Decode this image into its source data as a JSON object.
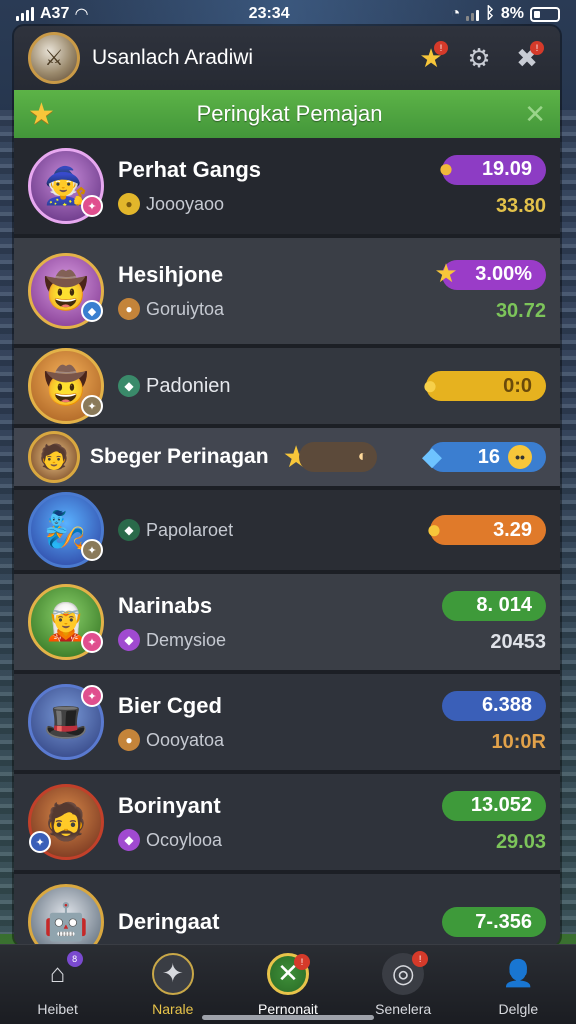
{
  "status": {
    "carrier": "A37",
    "time": "23:34",
    "battery": "8%"
  },
  "header": {
    "title": "Usanlach Aradiwi"
  },
  "banner": {
    "title": "Peringkat Pemajan"
  },
  "players": [
    {
      "name": "Perhat Gangs",
      "sub": "Joooyaoo",
      "pill": "19.09",
      "pill_color": "#8d3cc4",
      "value": "33.80",
      "value_color": "#e2c14a"
    },
    {
      "name": "Hesihjone",
      "sub": "Goruiytoa",
      "pill": "3.00%",
      "pill_color": "#9a3cc8",
      "value": "30.72",
      "value_color": "#7cc45a"
    },
    {
      "name": "",
      "sub": "Padonien",
      "pill": "0:0",
      "pill_color": "#e6b21f",
      "value": ""
    },
    {
      "name": "Sbeger Perinagan",
      "sub": "",
      "pill": "16",
      "pill_color": "#3b7ed0",
      "value": ""
    },
    {
      "name": "",
      "sub": "Papolaroet",
      "pill": "3.29",
      "pill_color": "#e07a2a",
      "value": ""
    },
    {
      "name": "Narinabs",
      "sub": "Demysioe",
      "pill": "8. 014",
      "pill_color": "#3e9a3a",
      "value": "20453",
      "value_color": "#dfe2e8"
    },
    {
      "name": "Bier Cged",
      "sub": "Oooyatoa",
      "pill": "6.388",
      "pill_color": "#3a5fb8",
      "value": "10:0R",
      "value_color": "#e2a24a"
    },
    {
      "name": "Borinyant",
      "sub": "Ocoylooa",
      "pill": "13.052",
      "pill_color": "#3e9a3a",
      "value": "29.03",
      "value_color": "#7cc45a"
    },
    {
      "name": "Deringaat",
      "sub": "",
      "pill": "7-.356",
      "pill_color": "#3e9a3a",
      "value": ""
    }
  ],
  "nav": [
    {
      "label": "Heibet",
      "icon": "home-icon"
    },
    {
      "label": "Narale",
      "icon": "compass-icon"
    },
    {
      "label": "Pernonait",
      "icon": "swords-icon"
    },
    {
      "label": "Senelera",
      "icon": "target-icon"
    },
    {
      "label": "Delgle",
      "icon": "profile-icon"
    }
  ]
}
